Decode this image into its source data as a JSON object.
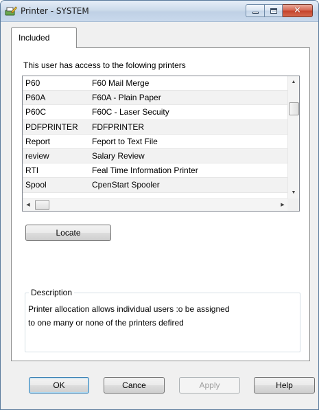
{
  "window": {
    "title": "Printer - SYSTEM",
    "icon": "printer-pencil-icon"
  },
  "caption_buttons": {
    "minimize": "minimize-icon",
    "maximize": "maximize-icon",
    "close": "✕"
  },
  "tabs": [
    {
      "label": "Included"
    }
  ],
  "panel": {
    "access_label": "This user has access to the folowing printers",
    "printers": [
      {
        "name": "P60",
        "description": "F60 Mail Merge"
      },
      {
        "name": "P60A",
        "description": "F60A - Plain Paper"
      },
      {
        "name": "P60C",
        "description": "F60C - Laser Secuity"
      },
      {
        "name": "PDFPRINTER",
        "description": "FDFPRINTER"
      },
      {
        "name": "Report",
        "description": "Feport to Text File"
      },
      {
        "name": "review",
        "description": "Salary Review"
      },
      {
        "name": "RTI",
        "description": "Feal Time Information Printer"
      },
      {
        "name": "Spool",
        "description": "CpenStart Spooler"
      }
    ],
    "locate_label": "Locate",
    "description": {
      "title": "Description",
      "text_line1": "Printer allocation allows individual users :o be assigned",
      "text_line2": "to one many or none of the printers defired"
    }
  },
  "footer": {
    "ok_label": "OK",
    "cancel_label": "Cance",
    "apply_label": "Apply",
    "help_label": "Help"
  },
  "colors": {
    "title_gradient": "#cddbeb",
    "close_button": "#c4412a",
    "default_button_border": "#3c7fb1",
    "row_alt": "#f2f2f2"
  }
}
